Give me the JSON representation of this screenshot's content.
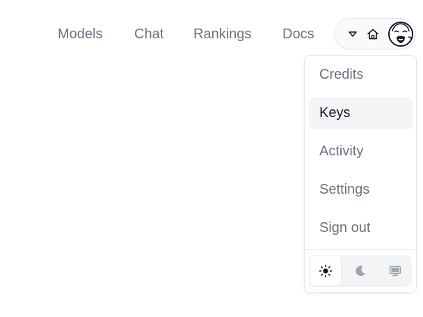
{
  "nav": {
    "links": [
      {
        "label": "Models"
      },
      {
        "label": "Chat"
      },
      {
        "label": "Rankings"
      },
      {
        "label": "Docs"
      }
    ]
  },
  "controls": {
    "chevron_icon": "chevron-down-icon",
    "home_icon": "home-icon",
    "avatar_icon": "avatar"
  },
  "menu": {
    "items": [
      {
        "label": "Credits"
      },
      {
        "label": "Keys",
        "active": true
      },
      {
        "label": "Activity"
      },
      {
        "label": "Settings"
      },
      {
        "label": "Sign out"
      }
    ],
    "theme": {
      "selected": "light",
      "options": [
        "sun-icon",
        "moon-icon",
        "monitor-icon"
      ]
    }
  },
  "colors": {
    "text_muted": "#6b7280",
    "text_active": "#111827",
    "border": "#e5e7eb",
    "hover_bg": "#f3f4f6"
  }
}
